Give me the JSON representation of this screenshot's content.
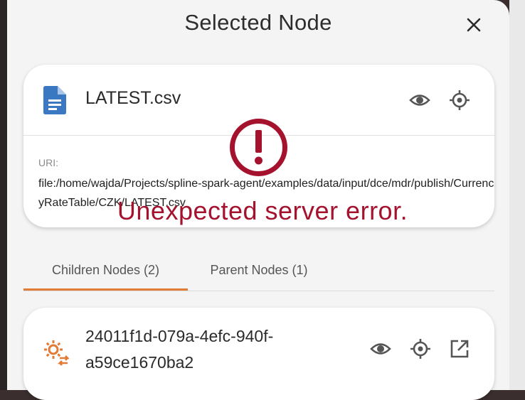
{
  "panel": {
    "title": "Selected Node",
    "close_icon": "close-icon"
  },
  "selected_node": {
    "name": "LATEST.csv",
    "icon": "file-document-icon",
    "uri_label": "URI:",
    "uri": "file:/home/wajda/Projects/spline-spark-agent/examples/data/input/dce/mdr/publish/CurrencyRateTable/CZK/LATEST.csv",
    "actions": [
      "eye-icon",
      "crosshair-icon"
    ]
  },
  "error": {
    "icon": "error-exclamation-icon",
    "message": "Unexpected server error."
  },
  "tabs": [
    {
      "label": "Children Nodes (2)",
      "active": true
    },
    {
      "label": "Parent Nodes (1)",
      "active": false
    }
  ],
  "children": [
    {
      "id": "24011f1d-079a-4efc-940f-a59ce1670ba2",
      "icon": "gear-sync-icon",
      "actions": [
        "eye-icon",
        "crosshair-icon",
        "open-in-new-icon"
      ]
    }
  ],
  "colors": {
    "accent": "#e27b36",
    "error": "#a5122e",
    "file_icon": "#3a78c2",
    "icon_gray": "#555555"
  }
}
